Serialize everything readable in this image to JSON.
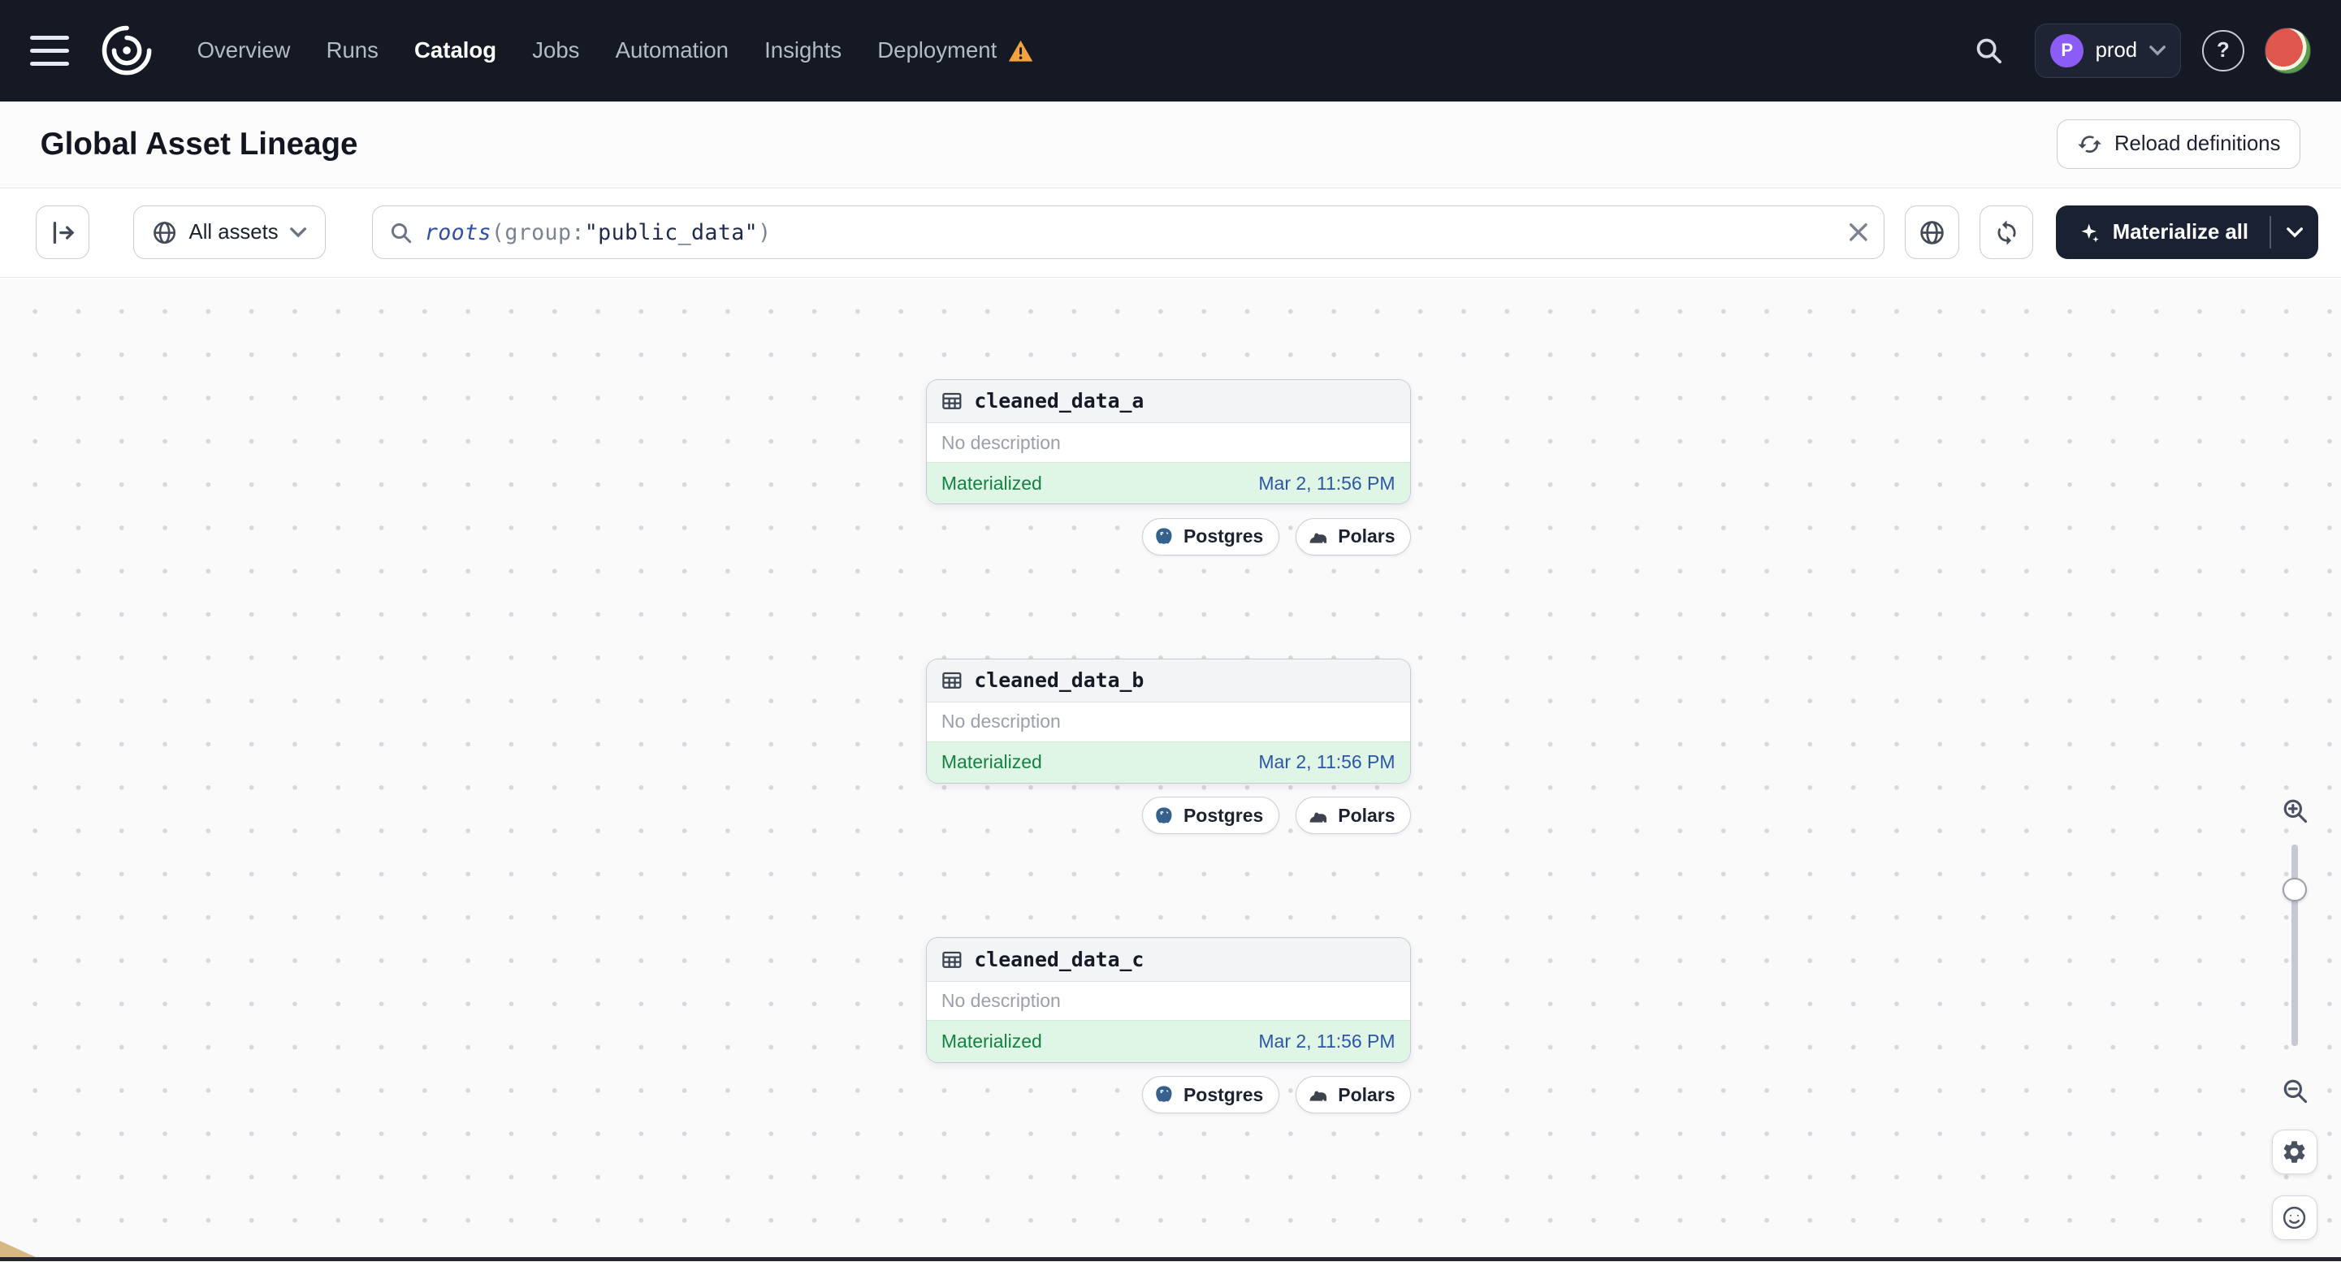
{
  "nav": {
    "items": [
      "Overview",
      "Runs",
      "Catalog",
      "Jobs",
      "Automation",
      "Insights",
      "Deployment"
    ],
    "active_item": "Catalog",
    "env": {
      "initial": "P",
      "name": "prod"
    },
    "help_glyph": "?"
  },
  "header": {
    "title": "Global Asset Lineage",
    "reload_button": "Reload definitions"
  },
  "toolbar": {
    "scope": "All assets",
    "query": {
      "fn": "roots",
      "open": "(",
      "key": "group:",
      "value": "\"public_data\"",
      "close": ")"
    },
    "materialize": "Materialize all"
  },
  "graph": {
    "nodes": [
      {
        "name": "cleaned_data_a",
        "description": "No description",
        "status": "Materialized",
        "timestamp": "Mar 2, 11:56 PM",
        "tags": [
          "Postgres",
          "Polars"
        ]
      },
      {
        "name": "cleaned_data_b",
        "description": "No description",
        "status": "Materialized",
        "timestamp": "Mar 2, 11:56 PM",
        "tags": [
          "Postgres",
          "Polars"
        ]
      },
      {
        "name": "cleaned_data_c",
        "description": "No description",
        "status": "Materialized",
        "timestamp": "Mar 2, 11:56 PM",
        "tags": [
          "Postgres",
          "Polars"
        ]
      }
    ]
  },
  "icons": {
    "hamburger-icon": "three horizontal bars",
    "dagster-logo": "white swirl",
    "warning-icon": "orange triangle !",
    "search-icon": "magnifier",
    "chevron-down-icon": "caret",
    "help-icon": "? in circle",
    "user-avatar": "watermelon photo circle",
    "reload-icon": "circular arrows",
    "panel-toggle-icon": "bar with right arrow",
    "globe-icon": "globe",
    "clear-icon": "x",
    "sync-icon": "refresh arrows",
    "sparkle-icon": "four point star",
    "table-icon": "grid table",
    "postgres-icon": "blue elephant mark",
    "polars-icon": "bear silhouette",
    "zoom-in-icon": "magnifier plus",
    "zoom-out-icon": "magnifier minus",
    "gear-icon": "settings gear",
    "smiley-icon": "smiley face"
  },
  "colors": {
    "nav_bg": "#151923",
    "accent_purple": "#8B5CF6",
    "warning_orange": "#F2A33C",
    "materialized_green": "#148342",
    "materialized_bg": "#DFF6E6",
    "timestamp_blue": "#2E56A6",
    "dark_button": "#1A2133"
  }
}
